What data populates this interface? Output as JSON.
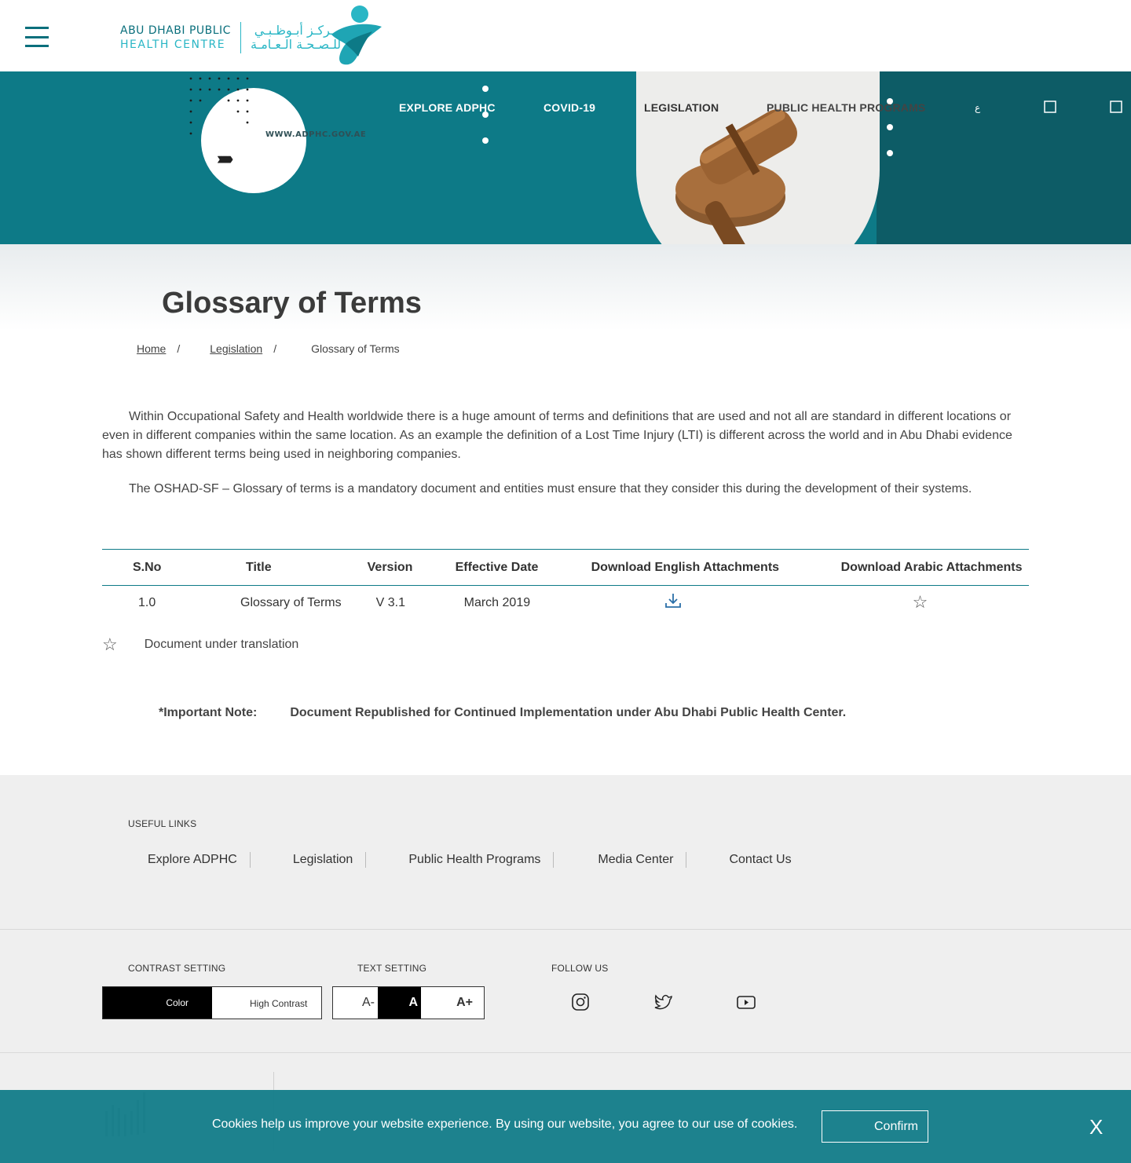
{
  "header": {
    "menu_icon": "hamburger-icon",
    "logo_en_line1": "ABU DHABI PUBLIC",
    "logo_en_line2": "HEALTH CENTRE",
    "logo_ar_line1": "مـركـز أبـوظـبـي",
    "logo_ar_line2": "للـصـحـة الـعـامـة"
  },
  "hero": {
    "url": "WWW.ADPHC.GOV.AE",
    "nav": [
      {
        "label": "EXPLORE ADPHC"
      },
      {
        "label": "COVID-19"
      },
      {
        "label": "LEGISLATION"
      },
      {
        "label": "PUBLIC HEALTH PROGRAMS"
      }
    ],
    "language_icon": "language-icon",
    "search_icon": "search-icon",
    "accessibility_icon": "accessibility-icon"
  },
  "page": {
    "title": "Glossary of Terms",
    "breadcrumb": {
      "home": "Home",
      "section": "Legislation",
      "current": "Glossary of Terms",
      "separator": "/"
    },
    "intro_p1": "Within Occupational Safety and Health worldwide there is a huge amount of terms and definitions that are used and not all are standard in different locations or even in different companies within the same location. As an example the definition of a Lost Time Injury (LTI) is different across the world and in Abu Dhabi evidence has shown different terms being used in neighboring companies.",
    "intro_p2": "The OSHAD-SF – Glossary of terms is a mandatory document and entities must ensure that they consider this during the development of their systems."
  },
  "table": {
    "headers": {
      "sno": "S.No",
      "title": "Title",
      "version": "Version",
      "effective_date": "Effective Date",
      "english": "Download English Attachments",
      "arabic": "Download Arabic Attachments"
    },
    "rows": [
      {
        "sno": "1.0",
        "title": "Glossary of Terms",
        "version": "V 3.1",
        "effective_date": "March 2019",
        "english_icon": "download-icon",
        "arabic_icon": "star-icon"
      }
    ]
  },
  "legend": {
    "icon": "star-icon",
    "text": "Document under translation"
  },
  "note": {
    "label": "*Important Note:",
    "text": "Document Republished for Continued Implementation under Abu Dhabi Public Health Center."
  },
  "footer": {
    "useful_links_heading": "USEFUL LINKS",
    "links": [
      "Explore ADPHC",
      "Legislation",
      "Public Health Programs",
      "Media Center",
      "Contact Us"
    ],
    "contrast_heading": "CONTRAST SETTING",
    "contrast_color": "Color",
    "contrast_high": "High Contrast",
    "text_heading": "TEXT SETTING",
    "text_decrease": "A-",
    "text_normal": "A",
    "text_increase": "A+",
    "follow_heading": "FOLLOW US",
    "social_icons": [
      "instagram-icon",
      "twitter-icon",
      "youtube-icon"
    ]
  },
  "cookie": {
    "text": "Cookies help us improve your website experience. By using our website, you agree to our use of cookies.",
    "confirm": "Confirm",
    "close": "X"
  },
  "colors": {
    "brand_teal": "#0d7a87",
    "brand_dark": "#0d5c66",
    "brand_light": "#29b6c5"
  }
}
